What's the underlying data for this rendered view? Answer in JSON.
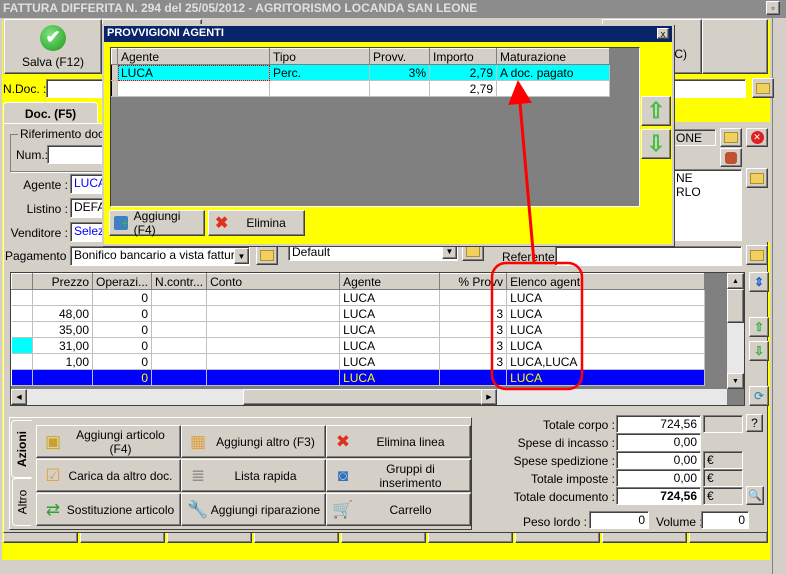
{
  "window": {
    "title": "FATTURA DIFFERITA N. 294  del 25/05/2012 - AGRITORISMO LOCANDA SAN LEONE"
  },
  "toolbar": {
    "save_label": "Salva (F12)",
    "partial_label": "C)"
  },
  "header": {
    "ndoc_label": "N.Doc. :",
    "ndoc_value": ""
  },
  "tabs": {
    "doc": "Doc. (F5)"
  },
  "form": {
    "riferimento_label": "Riferimento docu",
    "num_label": "Num.:",
    "num_value": "",
    "agente_label": "Agente :",
    "agente_value": "LUCA",
    "listino_label": "Listino :",
    "listino_value": "DEFA",
    "venditore_label": "Venditore :",
    "venditore_value": "Selez",
    "pagamento_label": "Pagamento :",
    "pagamento_value": "Bonifico bancario a vista fattura",
    "default_value": "Default",
    "referente_label": "Referente",
    "referente_value": "",
    "cliente_partial": "ONE",
    "address_lines": [
      "NE",
      "RLO"
    ]
  },
  "grid": {
    "columns": [
      "Prezzo",
      "Operazi...",
      "N.contr...",
      "Conto",
      "Agente",
      "% Provv",
      "Elenco agenti"
    ],
    "rows": [
      {
        "prezzo": "",
        "oper": "0",
        "ncontr": "",
        "conto": "",
        "agente": "LUCA",
        "provv": "",
        "elenco": "LUCA"
      },
      {
        "prezzo": "48,00",
        "oper": "0",
        "ncontr": "",
        "conto": "",
        "agente": "LUCA",
        "provv": "3",
        "elenco": "LUCA"
      },
      {
        "prezzo": "35,00",
        "oper": "0",
        "ncontr": "",
        "conto": "",
        "agente": "LUCA",
        "provv": "3",
        "elenco": "LUCA"
      },
      {
        "prezzo": "31,00",
        "oper": "0",
        "ncontr": "",
        "conto": "",
        "agente": "LUCA",
        "provv": "3",
        "elenco": "LUCA"
      },
      {
        "prezzo": "1,00",
        "oper": "0",
        "ncontr": "",
        "conto": "",
        "agente": "LUCA",
        "provv": "3",
        "elenco": "LUCA,LUCA"
      },
      {
        "prezzo": "",
        "oper": "0",
        "ncontr": "",
        "conto": "",
        "agente": "LUCA",
        "provv": "",
        "elenco": "LUCA"
      }
    ],
    "selected_row": 5
  },
  "actions": {
    "tabs": [
      "Azioni",
      "Altro"
    ],
    "buttons": [
      "Aggiungi articolo (F4)",
      "Aggiungi altro (F3)",
      "Elimina linea",
      "Carica da altro doc.",
      "Lista rapida",
      "Gruppi di inserimento",
      "Sostituzione articolo",
      "Aggiungi riparazione",
      "Carrello"
    ]
  },
  "totals": {
    "totale_corpo_label": "Totale corpo :",
    "totale_corpo": "724,56",
    "spese_incasso_label": "Spese di incasso :",
    "spese_incasso": "0,00",
    "spese_spedizione_label": "Spese spedizione :",
    "spese_spedizione": "0,00",
    "totale_imposte_label": "Totale imposte :",
    "totale_imposte": "0,00",
    "totale_documento_label": "Totale documento :",
    "totale_documento": "724,56",
    "currency": "€",
    "help": "?",
    "peso_label": "Peso lordo :",
    "peso": "0",
    "volume_label": "Volume :",
    "volume": "0"
  },
  "dialog": {
    "title": "PROVVIGIONI AGENTI",
    "close": "x",
    "columns": [
      "Agente",
      "Tipo",
      "Provv.",
      "Importo",
      "Maturazione"
    ],
    "rows": [
      {
        "agente": "LUCA",
        "tipo": "Perc.",
        "provv": "3%",
        "importo": "2,79",
        "maturazione": "A doc. pagato"
      },
      {
        "agente": "",
        "tipo": "",
        "provv": "",
        "importo": "2,79",
        "maturazione": ""
      }
    ],
    "add_label": "Aggiungi (F4)",
    "delete_label": "Elimina"
  },
  "colors": {
    "yellow": "#ffff00",
    "selection": "#0000ff",
    "highlight": "#00ffff",
    "dialog_title": "#0a246a",
    "annotation": "#ff0000"
  }
}
